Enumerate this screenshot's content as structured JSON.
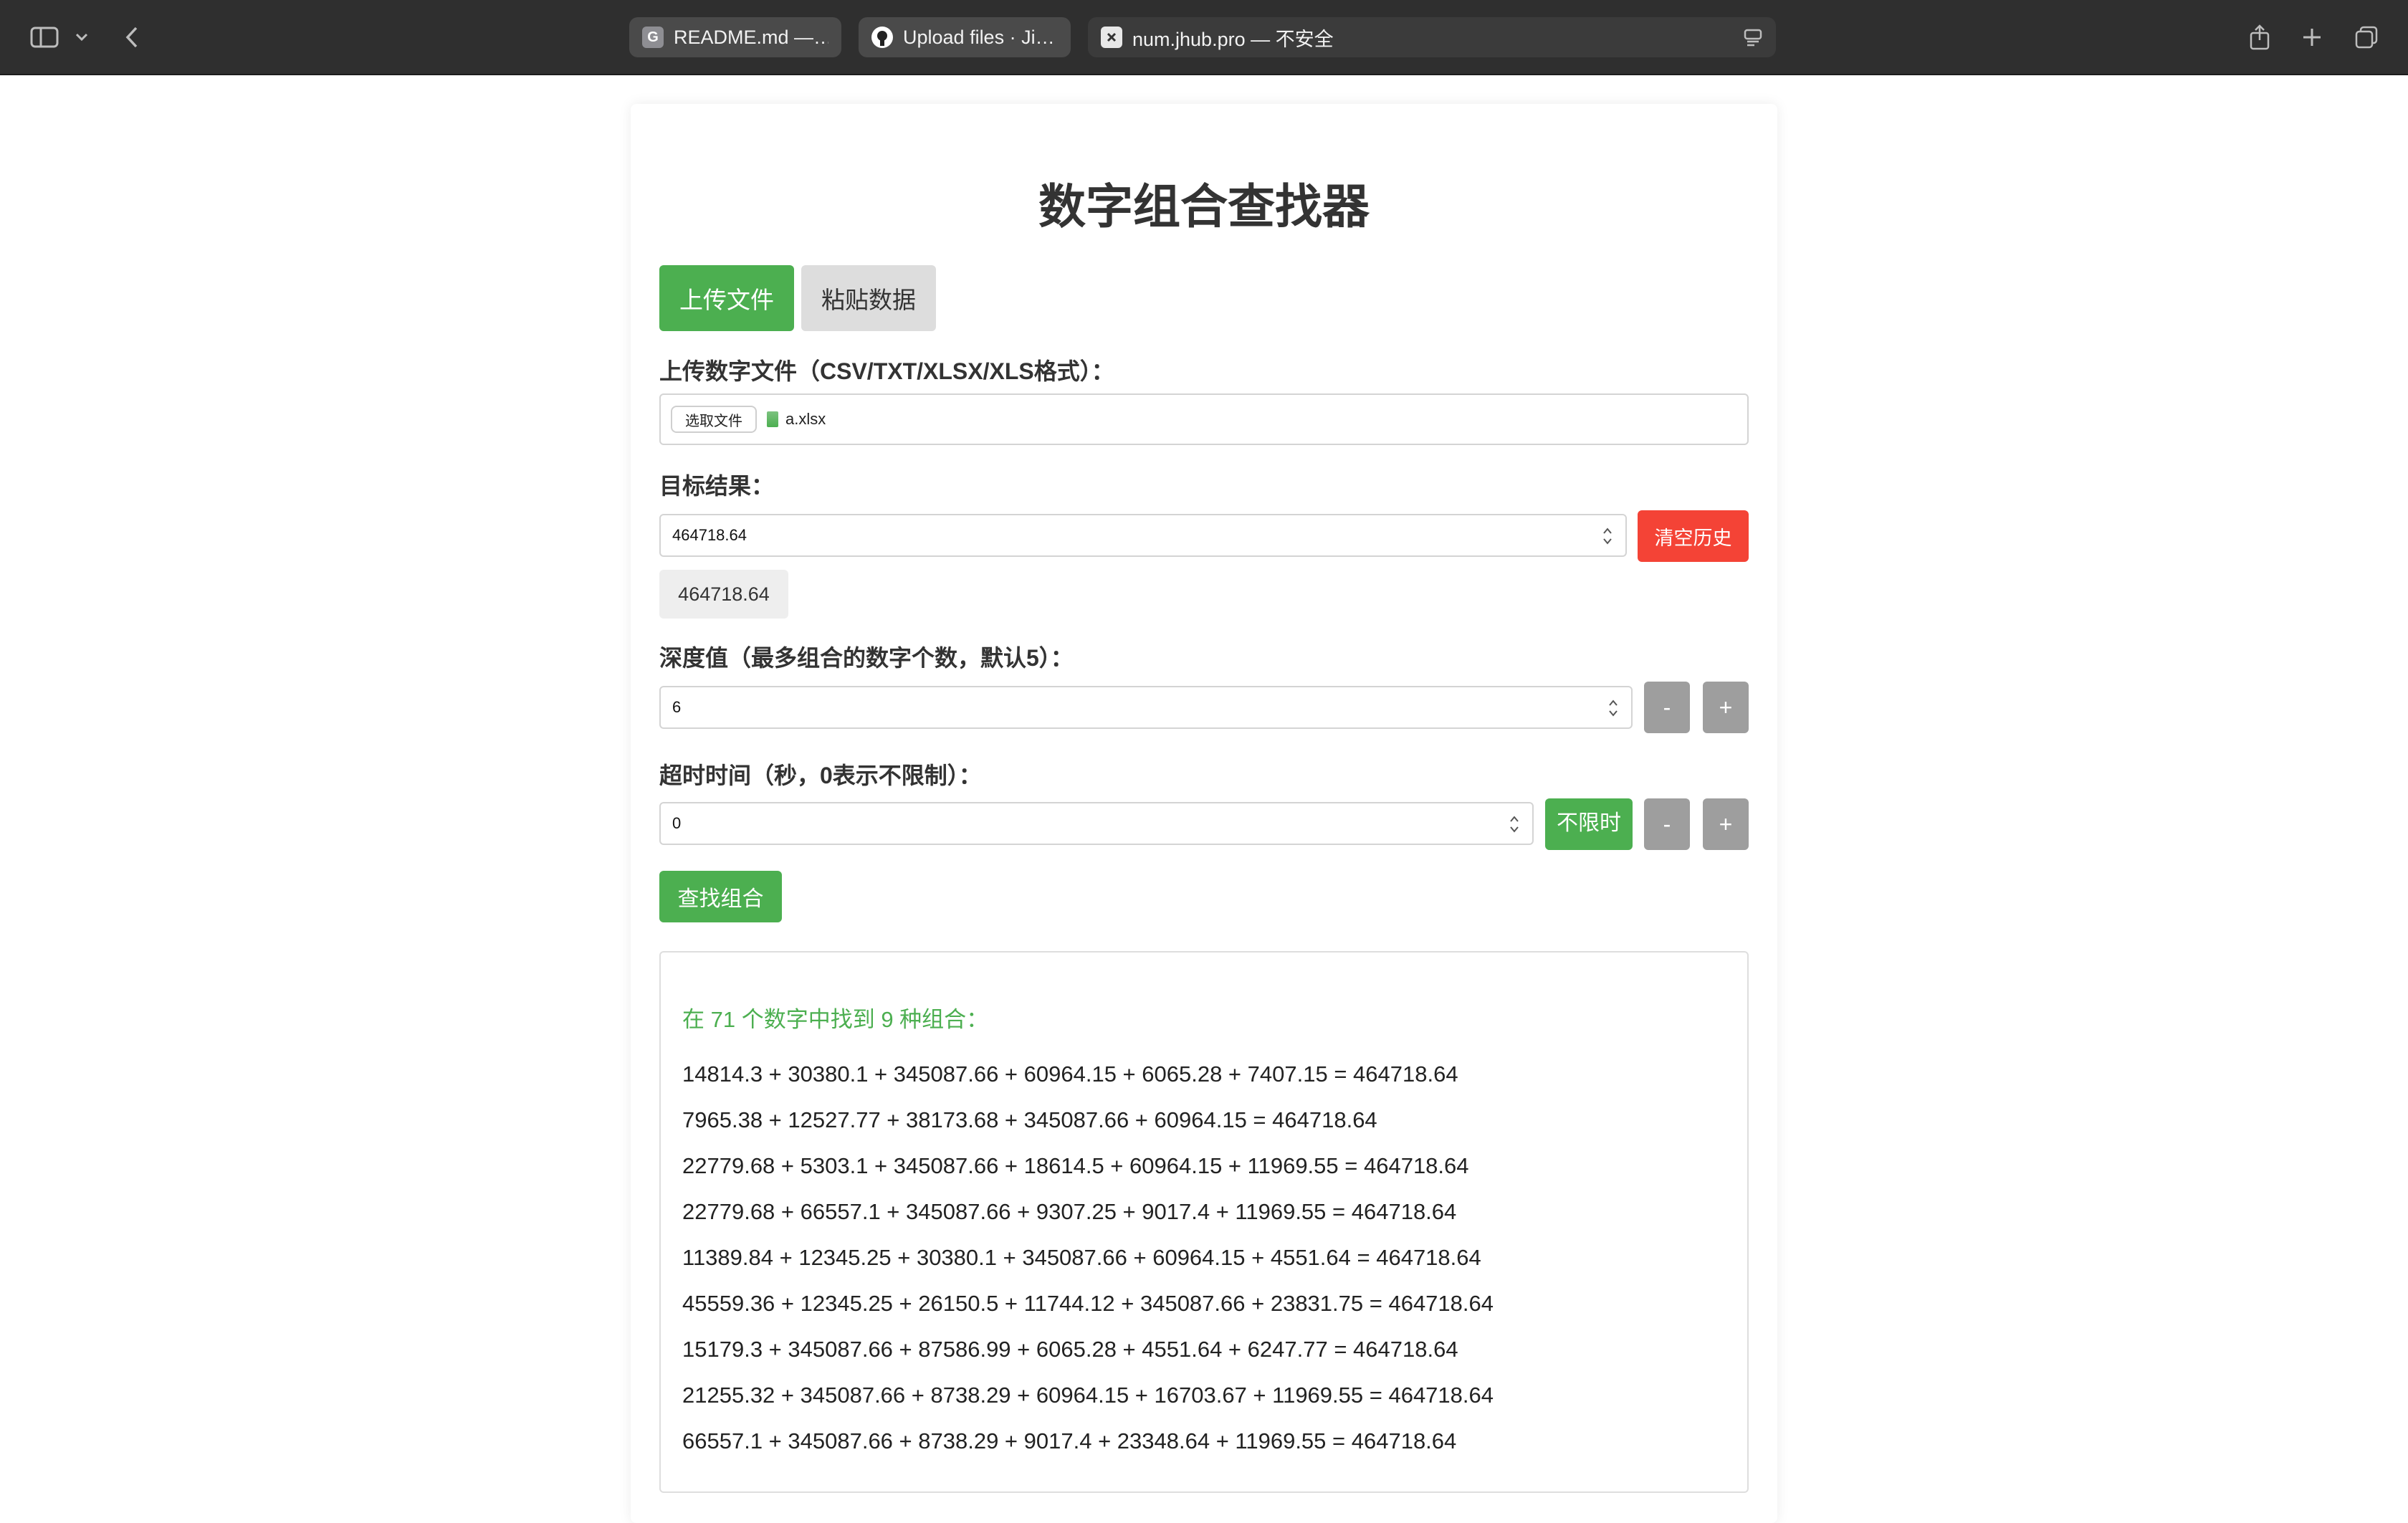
{
  "browser": {
    "tabs": [
      {
        "favicon": "G",
        "label": "README.md —…",
        "state": "inactive"
      },
      {
        "favicon": "github-icon",
        "label": "Upload files · Ji…",
        "state": "inactive"
      },
      {
        "favicon": "x-icon",
        "label": "num.jhub.pro — 不安全",
        "state": "active"
      }
    ]
  },
  "page": {
    "title": "数字组合查找器",
    "mode_tabs": {
      "upload": "上传文件",
      "paste": "粘贴数据"
    },
    "upload_label": "上传数字文件（CSV/TXT/XLSX/XLS格式）：",
    "file_button": "选取文件",
    "file_name": "a.xlsx",
    "target_label": "目标结果：",
    "target_value": "464718.64",
    "clear_history": "清空历史",
    "history_chip": "464718.64",
    "depth_label": "深度值（最多组合的数字个数，默认5）：",
    "depth_value": "6",
    "timeout_label": "超时时间（秒，0表示不限制）：",
    "timeout_value": "0",
    "unlimited_button": "不限时",
    "minus": "-",
    "plus": "+",
    "find_button": "查找组合"
  },
  "results": {
    "summary": "在 71 个数字中找到 9 种组合：",
    "lines": [
      "14814.3 + 30380.1 + 345087.66 + 60964.15 + 6065.28 + 7407.15 = 464718.64",
      "7965.38 + 12527.77 + 38173.68 + 345087.66 + 60964.15 = 464718.64",
      "22779.68 + 5303.1 + 345087.66 + 18614.5 + 60964.15 + 11969.55 = 464718.64",
      "22779.68 + 66557.1 + 345087.66 + 9307.25 + 9017.4 + 11969.55 = 464718.64",
      "11389.84 + 12345.25 + 30380.1 + 345087.66 + 60964.15 + 4551.64 = 464718.64",
      "45559.36 + 12345.25 + 26150.5 + 11744.12 + 345087.66 + 23831.75 = 464718.64",
      "15179.3 + 345087.66 + 87586.99 + 6065.28 + 4551.64 + 6247.77 = 464718.64",
      "21255.32 + 345087.66 + 8738.29 + 60964.15 + 16703.67 + 11969.55 = 464718.64",
      "66557.1 + 345087.66 + 8738.29 + 9017.4 + 23348.64 + 11969.55 = 464718.64"
    ]
  },
  "colors": {
    "primary_green": "#4caf50",
    "danger_red": "#f44336",
    "neutral_gray": "#9e9e9e",
    "chrome_bg": "#2f2f2f"
  }
}
